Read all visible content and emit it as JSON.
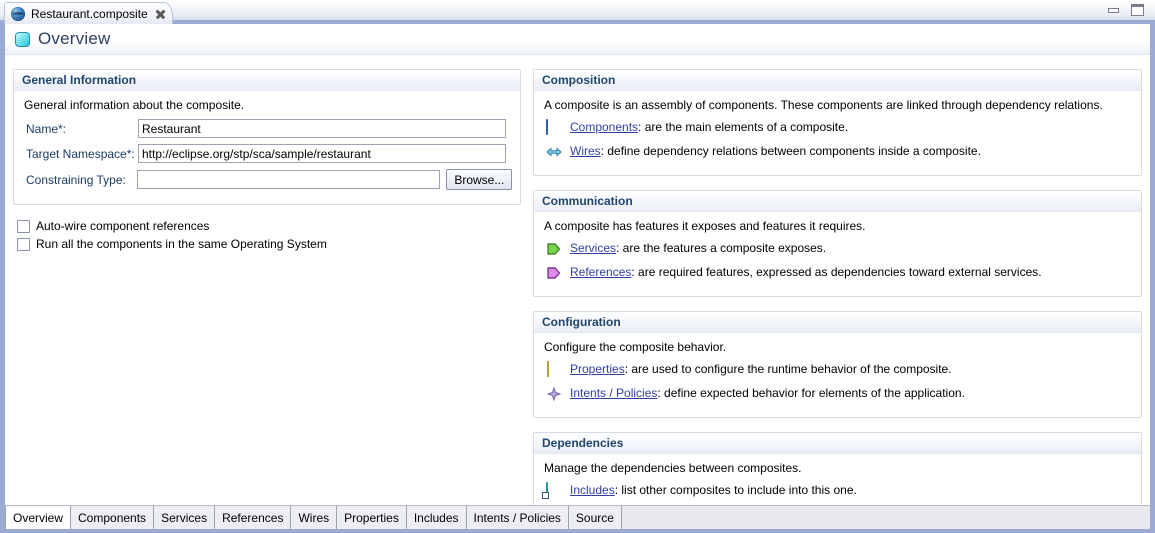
{
  "window": {
    "title_tab": "Restaurant.composite",
    "tab_icon": "composite-sphere-icon",
    "close_icon": "close-icon",
    "minimize_icon": "minimize-icon",
    "maximize_icon": "maximize-icon"
  },
  "form_header": {
    "icon": "overview-icon",
    "title": "Overview"
  },
  "left": {
    "general": {
      "header": "General Information",
      "description": "General information about the composite.",
      "fields": [
        {
          "label": "Name*:",
          "value": "Restaurant",
          "placeholder": ""
        },
        {
          "label": "Target Namespace*:",
          "value": "http://eclipse.org/stp/sca/sample/restaurant",
          "placeholder": ""
        },
        {
          "label": "Constraining Type:",
          "value": "",
          "placeholder": ""
        }
      ],
      "browse_label": "Browse...",
      "checkboxes": [
        {
          "label": "Auto-wire component references",
          "checked": false
        },
        {
          "label": "Run all the components in the same Operating System",
          "checked": false
        }
      ]
    }
  },
  "right": {
    "sections": [
      {
        "header": "Composition",
        "description": "A composite is an assembly of components. These components are linked through dependency relations.",
        "links": [
          {
            "icon": "component-icon",
            "link": "Components",
            "rest": ": are the main elements of a composite."
          },
          {
            "icon": "wires-icon",
            "link": "Wires",
            "rest": ": define dependency relations between components inside a composite."
          }
        ]
      },
      {
        "header": "Communication",
        "description": "A composite has features it exposes and features it requires.",
        "links": [
          {
            "icon": "service-icon",
            "link": "Services",
            "rest": ": are the features a composite exposes."
          },
          {
            "icon": "reference-icon",
            "link": "References",
            "rest": ": are required features, expressed as dependencies toward external services."
          }
        ]
      },
      {
        "header": "Configuration",
        "description": "Configure the composite behavior.",
        "links": [
          {
            "icon": "properties-icon",
            "link": "Properties",
            "rest": ": are used to configure the runtime behavior of the composite."
          },
          {
            "icon": "intents-policies-icon",
            "link": "Intents / Policies",
            "rest": ": define expected behavior for elements of the application."
          }
        ]
      },
      {
        "header": "Dependencies",
        "description": "Manage the dependencies between composites.",
        "links": [
          {
            "icon": "includes-icon",
            "link": "Includes",
            "rest": ": list other composites to include into this one."
          }
        ]
      }
    ]
  },
  "bottom_tabs": [
    {
      "label": "Overview",
      "active": true
    },
    {
      "label": "Components",
      "active": false
    },
    {
      "label": "Services",
      "active": false
    },
    {
      "label": "References",
      "active": false
    },
    {
      "label": "Wires",
      "active": false
    },
    {
      "label": "Properties",
      "active": false
    },
    {
      "label": "Includes",
      "active": false
    },
    {
      "label": "Intents / Policies",
      "active": false
    },
    {
      "label": "Source",
      "active": false
    }
  ],
  "colors": {
    "frame": "#9aaad2",
    "section_header_text": "#20456e",
    "link": "#2f3fa5",
    "label": "#1c3c66"
  }
}
